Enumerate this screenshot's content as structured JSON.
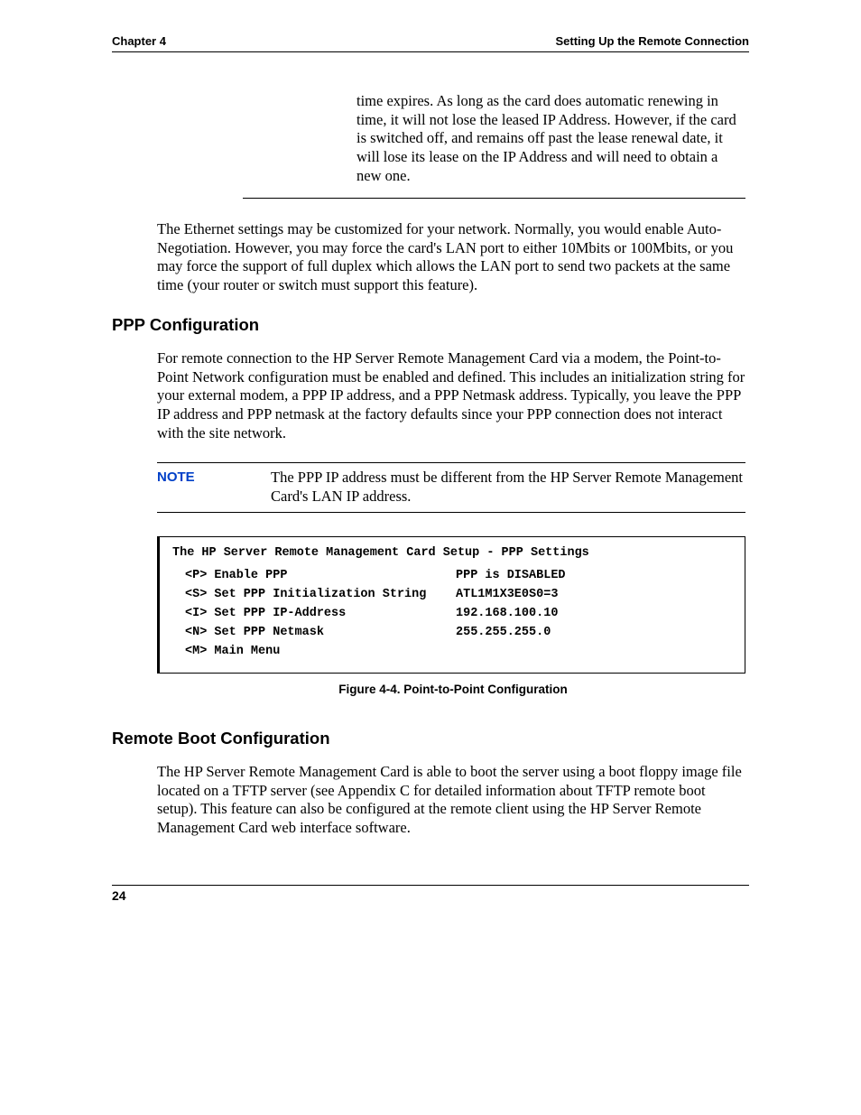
{
  "header": {
    "left": "Chapter 4",
    "right": "Setting Up the Remote Connection"
  },
  "continued_text": "time expires. As long as the card does automatic renewing in time, it will not lose the leased IP Address. However, if the card is switched off, and remains off past the lease renewal date, it will lose its lease on the IP Address and will need to obtain a new one.",
  "ethernet_para": "The Ethernet settings may be customized for your network. Normally, you would enable Auto-Negotiation. However, you may force the card's LAN port to either 10Mbits or 100Mbits, or you may force the support of full duplex which allows the LAN port to send two packets at the same time (your router or switch must support this feature).",
  "ppp": {
    "heading": "PPP Configuration",
    "para": "For remote connection to the HP Server Remote Management Card via a modem, the Point-to-Point Network configuration must be enabled and defined. This includes an initialization string for your external modem, a PPP IP address, and a PPP Netmask address. Typically, you leave the PPP IP address and PPP netmask at the factory defaults since your PPP connection does not interact with the site network.",
    "note_label": "NOTE",
    "note_text": "The PPP IP address must be different from the HP Server Remote Management Card's LAN IP address."
  },
  "terminal": {
    "title": "The HP Server Remote Management Card Setup - PPP Settings",
    "rows": [
      {
        "left": "<P> Enable PPP",
        "right": "PPP is DISABLED"
      },
      {
        "left": "<S> Set PPP Initialization String",
        "right": "ATL1M1X3E0S0=3"
      },
      {
        "left": "<I> Set PPP IP-Address",
        "right": "192.168.100.10"
      },
      {
        "left": "<N> Set PPP Netmask",
        "right": "255.255.255.0"
      },
      {
        "left": "<M> Main Menu",
        "right": ""
      }
    ]
  },
  "figure_caption": "Figure 4-4.  Point-to-Point Configuration",
  "remote_boot": {
    "heading": "Remote Boot Configuration",
    "para": "The HP Server Remote Management Card is able to boot the server using a boot floppy image file located on a TFTP server (see Appendix C for detailed information about TFTP remote boot setup).  This feature can also be configured at the remote client using the HP Server Remote Management Card web interface software."
  },
  "page_number": "24"
}
